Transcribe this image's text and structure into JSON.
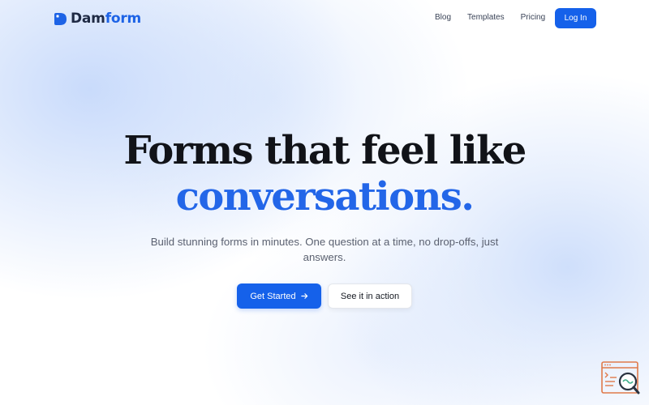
{
  "brand": {
    "name_part1": "Dam",
    "name_part2": "form",
    "accent_color": "#1d63e6"
  },
  "nav": {
    "links": [
      {
        "label": "Blog"
      },
      {
        "label": "Templates"
      },
      {
        "label": "Pricing"
      }
    ],
    "login_label": "Log In"
  },
  "hero": {
    "title_line1": "Forms that feel like",
    "title_line2": "conversations.",
    "subtitle": "Build stunning forms in minutes. One question at a time, no drop-offs, just answers.",
    "primary_cta": "Get Started",
    "secondary_cta": "See it in action"
  },
  "icons": {
    "logo": "logo-icon",
    "cta_arrow": "arrow-right-icon",
    "corner": "search-document-icon"
  },
  "colors": {
    "primary": "#1561ea",
    "title_accent": "#2366e8",
    "title_text": "#111318",
    "body_text": "#5b6170"
  }
}
